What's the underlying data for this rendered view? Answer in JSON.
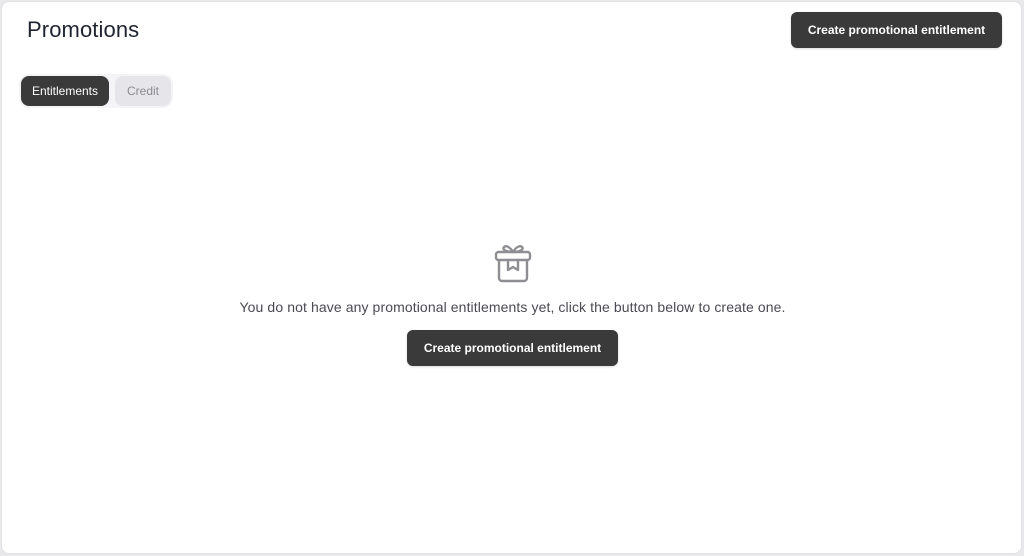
{
  "header": {
    "title": "Promotions",
    "create_button_label": "Create promotional entitlement"
  },
  "tabs": [
    {
      "label": "Entitlements",
      "active": true
    },
    {
      "label": "Credit",
      "active": false
    }
  ],
  "empty_state": {
    "icon": "gift-icon",
    "message": "You do not have any promotional entitlements yet, click the button below to create one.",
    "button_label": "Create promotional entitlement"
  },
  "colors": {
    "primary_button": "#3a3a3a",
    "inactive_tab": "#e6e6ea",
    "icon_stroke": "#8e8e93"
  }
}
